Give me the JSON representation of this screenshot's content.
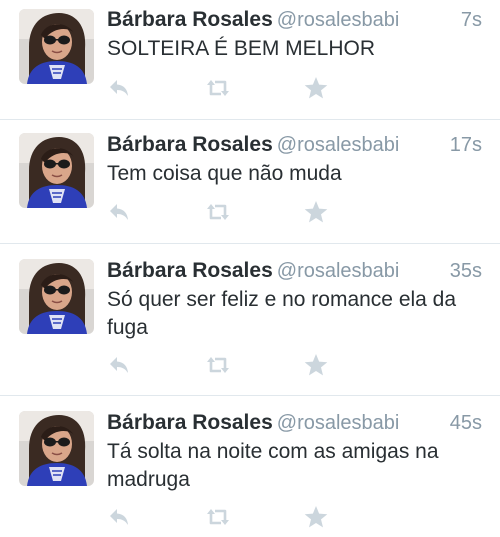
{
  "colors": {
    "name": "#292f33",
    "meta": "#8899a6",
    "icon": "#ccd6dd",
    "divider": "#e1e8ed"
  },
  "tweets": [
    {
      "name": "Bárbara Rosales",
      "handle": "@rosalesbabi",
      "time": "7s",
      "text": "SOLTEIRA É BEM MELHOR"
    },
    {
      "name": "Bárbara Rosales",
      "handle": "@rosalesbabi",
      "time": "17s",
      "text": "Tem coisa que não muda"
    },
    {
      "name": "Bárbara Rosales",
      "handle": "@rosalesbabi",
      "time": "35s",
      "text": "Só quer ser feliz e no romance ela da fuga"
    },
    {
      "name": "Bárbara Rosales",
      "handle": "@rosalesbabi",
      "time": "45s",
      "text": "Tá solta na noite com as amigas na madruga"
    }
  ],
  "icons": {
    "avatar": "avatar-photo",
    "reply": "reply-icon",
    "retweet": "retweet-icon",
    "favorite": "star-icon"
  }
}
